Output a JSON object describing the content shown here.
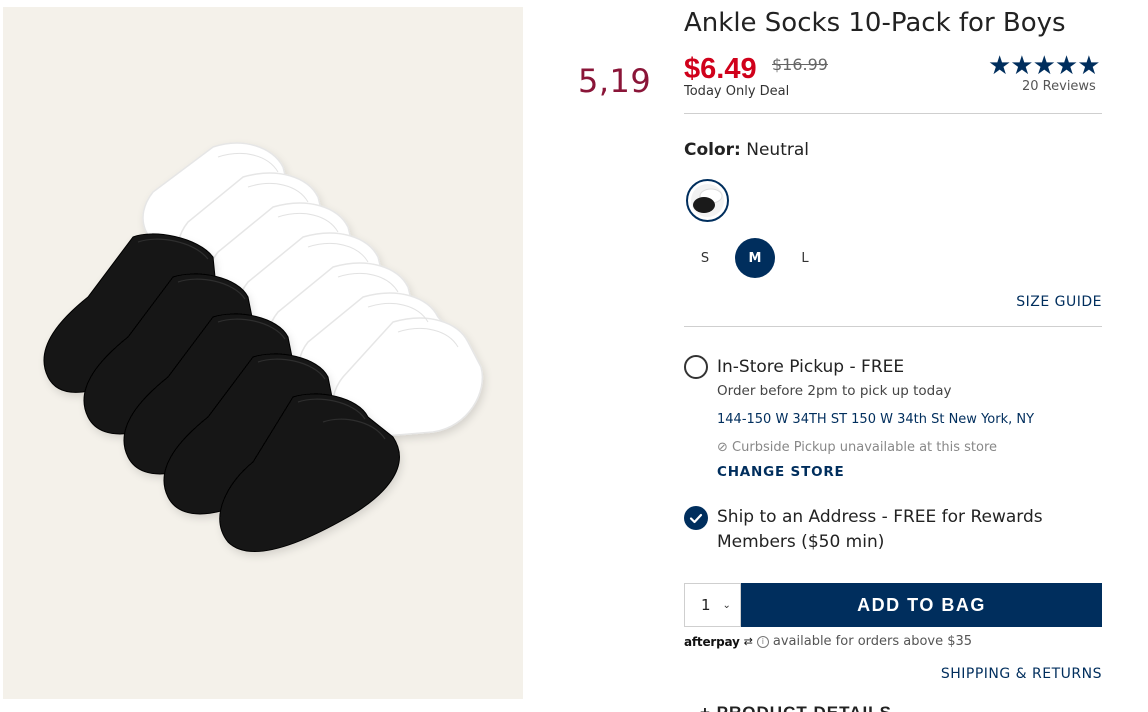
{
  "side_price": "5,19",
  "product": {
    "title": "Ankle Socks 10-Pack for Boys",
    "price": "$6.49",
    "original_price": "$16.99",
    "deal": "Today Only Deal",
    "stars": "★★★★★",
    "reviews": "20 Reviews"
  },
  "color": {
    "label": "Color:",
    "value": "Neutral"
  },
  "sizes": [
    "S",
    "M",
    "L"
  ],
  "selected_size": "M",
  "size_guide": "SIZE GUIDE",
  "pickup": {
    "title": "In-Store Pickup - FREE",
    "note": "Order before 2pm to pick up today",
    "address": "144-150 W 34TH ST 150 W 34th St New York, NY",
    "curbside": "Curbside Pickup unavailable at this store",
    "change_store": "CHANGE STORE"
  },
  "ship": {
    "title_line1": "Ship to an Address - FREE for Rewards",
    "title_line2": "Members ($50 min)"
  },
  "quantity": "1",
  "add_to_bag": "ADD TO BAG",
  "afterpay": {
    "logo": "afterpay",
    "text": "available for orders above $35"
  },
  "shipping_returns": "SHIPPING & RETURNS",
  "product_details": "PRODUCT DETAILS",
  "colors": {
    "accent": "#002e5d",
    "sale": "#d0011b",
    "side_price": "#8a1538"
  }
}
